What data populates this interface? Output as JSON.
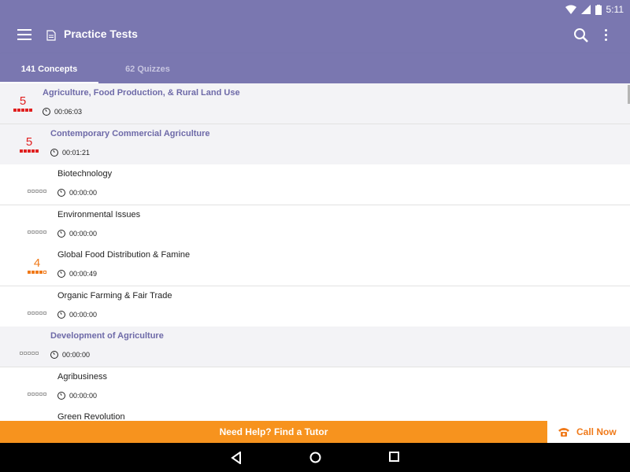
{
  "status": {
    "time": "5:11"
  },
  "appbar": {
    "title": "Practice Tests",
    "icons": [
      "menu-icon",
      "document-icon",
      "search-icon",
      "more-vert-icon"
    ]
  },
  "tabs": [
    {
      "label": "141 Concepts",
      "active": true
    },
    {
      "label": "62 Quizzes",
      "active": false
    }
  ],
  "rows": [
    {
      "name": "Agriculture, Food Production, & Rural Land Use",
      "time": "00:06:03",
      "level": 1,
      "score": "5",
      "score_level": 5,
      "color": "red"
    },
    {
      "name": "Contemporary Commercial Agriculture",
      "time": "00:01:21",
      "level": 2,
      "score": "5",
      "score_level": 5,
      "color": "red"
    },
    {
      "name": "Biotechnology",
      "time": "00:00:00",
      "level": 3,
      "score": "",
      "score_level": 0,
      "color": "empty"
    },
    {
      "name": "Environmental Issues",
      "time": "00:00:00",
      "level": 3,
      "score": "",
      "score_level": 0,
      "color": "empty"
    },
    {
      "name": "Global Food Distribution & Famine",
      "time": "00:00:49",
      "level": 3,
      "score": "4",
      "score_level": 4,
      "color": "orange"
    },
    {
      "name": "Organic Farming & Fair Trade",
      "time": "00:00:00",
      "level": 3,
      "score": "",
      "score_level": 0,
      "color": "empty"
    },
    {
      "name": "Development of Agriculture",
      "time": "00:00:00",
      "level": 2,
      "score": "",
      "score_level": 0,
      "color": "empty"
    },
    {
      "name": "Agribusiness",
      "time": "00:00:00",
      "level": 3,
      "score": "",
      "score_level": 0,
      "color": "empty"
    },
    {
      "name": "Green Revolution",
      "time": "",
      "level": 3,
      "score": "",
      "score_level": 0,
      "color": "empty"
    }
  ],
  "banner": {
    "help": "Need Help? Find a Tutor",
    "call": "Call Now"
  },
  "colors": {
    "primary": "#7a77b0",
    "accent": "#f7931e",
    "score_red": "#e02020",
    "score_orange": "#f07a1a"
  }
}
